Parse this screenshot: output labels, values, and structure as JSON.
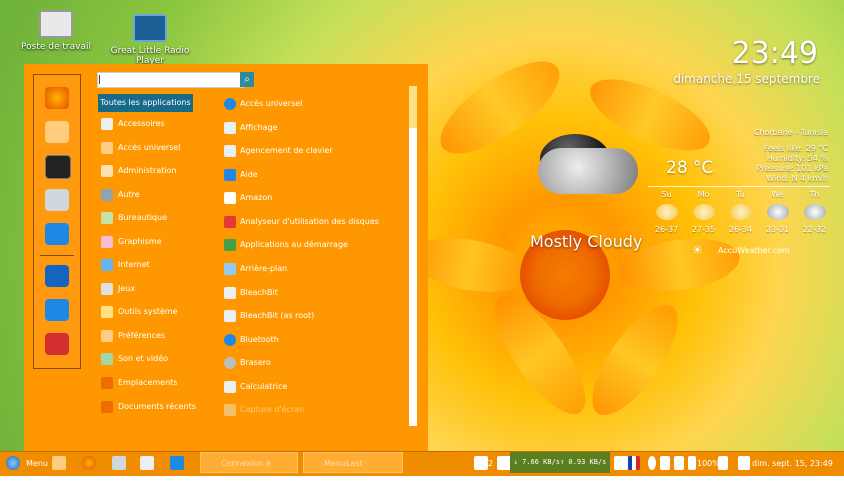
{
  "desktop": {
    "icons": [
      {
        "label": "Poste de travail"
      },
      {
        "label": "Great Little Radio Player"
      }
    ]
  },
  "clock": {
    "time": "23:49",
    "date": "dimanche,15 septembre"
  },
  "weather": {
    "location": "Chorbane - Tunisia",
    "feels_like": "Feels like: 29 °C",
    "humidity": "Humidity: 54 %",
    "pressure": "Pressure: 101 kPa",
    "wind": "Wind: N 4 km/h",
    "temperature": "28 °C",
    "condition": "Mostly Cloudy",
    "provider": "AccuWeather.com",
    "forecast": [
      {
        "day": "Su",
        "range": "26-37"
      },
      {
        "day": "Mo",
        "range": "27-35"
      },
      {
        "day": "Tu",
        "range": "26-34"
      },
      {
        "day": "We",
        "range": "23-31"
      },
      {
        "day": "Th",
        "range": "22-32"
      }
    ]
  },
  "menu": {
    "search_placeholder": "",
    "selected_category": "Toutes les applications",
    "categories": [
      "Accessoires",
      "Accès universel",
      "Administration",
      "Autre",
      "Bureautique",
      "Graphisme",
      "Internet",
      "Jeux",
      "Outils système",
      "Préférences",
      "Son et vidéo",
      "Emplacements",
      "Documents récents"
    ],
    "apps": [
      "Accès universel",
      "Affichage",
      "Agencement de clavier",
      "Aide",
      "Amazon",
      "Analyseur d'utilisation des disques",
      "Applications au démarrage",
      "Arrière-plan",
      "BleachBit",
      "BleachBit (as root)",
      "Bluetooth",
      "Brasero",
      "Calculatrice",
      "Capture d'écran"
    ],
    "favorites": [
      "firefox-icon",
      "system-tools-icon",
      "terminal-icon",
      "folder-icon",
      "screenshot-icon",
      "lock-icon",
      "logout-icon",
      "power-icon"
    ]
  },
  "taskbar": {
    "menu_label": "Menu",
    "window1": "Connexion à Internet...",
    "window2": "MenuLast",
    "netspeed": "↓ 7.66 KB/s↑ 0.93 KB/s",
    "notification_count": "2",
    "battery": "100%",
    "datetime": "dim. sept. 15, 23:49"
  }
}
